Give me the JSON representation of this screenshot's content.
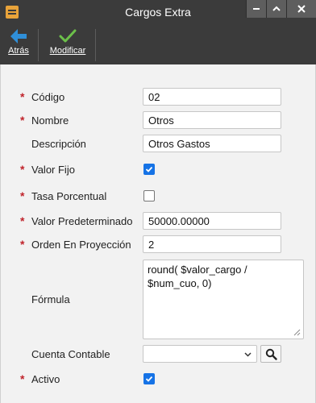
{
  "window": {
    "title": "Cargos Extra",
    "app_icon": "app-grid-icon",
    "controls": [
      "minimize-icon",
      "maximize-icon",
      "close-icon"
    ]
  },
  "toolbar": {
    "back_label": "Atrás",
    "modify_label": "Modificar"
  },
  "form": {
    "codigo": {
      "label": "Código",
      "value": "02",
      "required": true
    },
    "nombre": {
      "label": "Nombre",
      "value": "Otros",
      "required": true
    },
    "descripcion": {
      "label": "Descripción",
      "value": "Otros Gastos",
      "required": false
    },
    "valor_fijo": {
      "label": "Valor Fijo",
      "checked": true,
      "required": true
    },
    "tasa_porcentual": {
      "label": "Tasa Porcentual",
      "checked": false,
      "required": true
    },
    "valor_predeterminado": {
      "label": "Valor Predeterminado",
      "value": "50000.00000",
      "required": true
    },
    "orden_proyeccion": {
      "label": "Orden En Proyección",
      "value": "2",
      "required": true
    },
    "formula": {
      "label": "Fórmula",
      "value": "round( $valor_cargo / $num_cuo, 0)",
      "required": false
    },
    "cuenta_contable": {
      "label": "Cuenta Contable",
      "value": "",
      "required": false
    },
    "activo": {
      "label": "Activo",
      "checked": true,
      "required": true
    },
    "required_marker": "*"
  },
  "colors": {
    "titlebar": "#3b3b3b",
    "required": "#c0232b",
    "checkbox_accent": "#1673e6",
    "back_arrow": "#2f8fd8",
    "check_icon": "#6cc04a"
  }
}
